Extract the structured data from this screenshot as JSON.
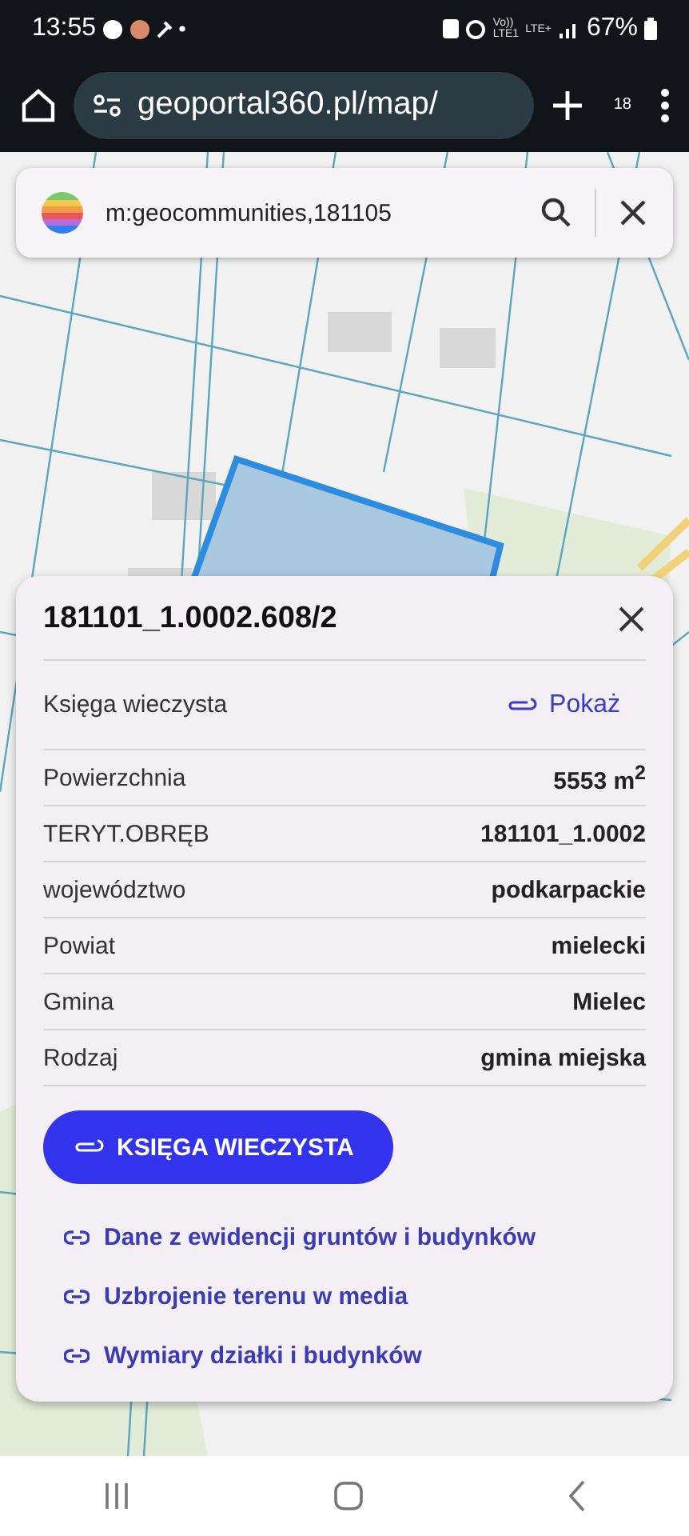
{
  "status_bar": {
    "time": "13:55",
    "volte": [
      "Vo))",
      "LTE1"
    ],
    "network": "LTE+",
    "battery": "67%"
  },
  "browser": {
    "url": "geoportal360.pl/map/",
    "tab_count": "18"
  },
  "search": {
    "value": "m:geocommunities,181105"
  },
  "panel": {
    "title": "181101_1.0002.608/2",
    "land_register": {
      "label": "Księga wieczysta",
      "link": "Pokaż"
    },
    "rows": [
      {
        "label": "Powierzchnia",
        "value": "5553 m$^{2}$"
      },
      {
        "label": "TERYT.OBRĘB",
        "value": "181101_1.0002"
      },
      {
        "label": "województwo",
        "value": "podkarpackie"
      },
      {
        "label": "Powiat",
        "value": "mielecki"
      },
      {
        "label": "Gmina",
        "value": "Mielec"
      },
      {
        "label": "Rodzaj",
        "value": "gmina miejska"
      }
    ],
    "button": "KSIĘGA WIECZYSTA",
    "links": [
      "Dane z ewidencji gruntów i budynków",
      "Uzbrojenie terenu w media",
      "Wymiary działki i budynków"
    ]
  }
}
